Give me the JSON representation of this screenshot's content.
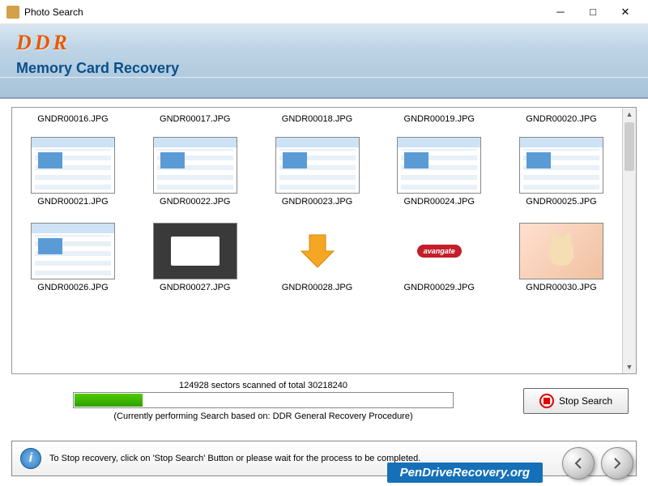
{
  "window": {
    "title": "Photo Search"
  },
  "header": {
    "brand": "DDR",
    "subtitle": "Memory Card Recovery"
  },
  "grid": {
    "row1": [
      {
        "name": "GNDR00016.JPG"
      },
      {
        "name": "GNDR00017.JPG"
      },
      {
        "name": "GNDR00018.JPG"
      },
      {
        "name": "GNDR00019.JPG"
      },
      {
        "name": "GNDR00020.JPG"
      }
    ],
    "row2": [
      {
        "name": "GNDR00021.JPG",
        "kind": "ui"
      },
      {
        "name": "GNDR00022.JPG",
        "kind": "ui"
      },
      {
        "name": "GNDR00023.JPG",
        "kind": "ui"
      },
      {
        "name": "GNDR00024.JPG",
        "kind": "ui"
      },
      {
        "name": "GNDR00025.JPG",
        "kind": "ui"
      }
    ],
    "row3": [
      {
        "name": "GNDR00026.JPG",
        "kind": "ui"
      },
      {
        "name": "GNDR00027.JPG",
        "kind": "web"
      },
      {
        "name": "GNDR00028.JPG",
        "kind": "arrow"
      },
      {
        "name": "GNDR00029.JPG",
        "kind": "logo",
        "logo_text": "avangate"
      },
      {
        "name": "GNDR00030.JPG",
        "kind": "card"
      }
    ]
  },
  "progress": {
    "text": "124928 sectors scanned of total 30218240",
    "note": "(Currently performing Search based on:  DDR General Recovery Procedure)",
    "percent": 18
  },
  "buttons": {
    "stop": "Stop Search"
  },
  "info": {
    "text": "To Stop recovery, click on 'Stop Search' Button or please wait for the process to be completed."
  },
  "watermark": "PenDriveRecovery.org",
  "colors": {
    "brand_orange": "#e85a00",
    "header_blue": "#0a4f8a",
    "progress_green": "#2ea000",
    "stop_red": "#d00000"
  }
}
